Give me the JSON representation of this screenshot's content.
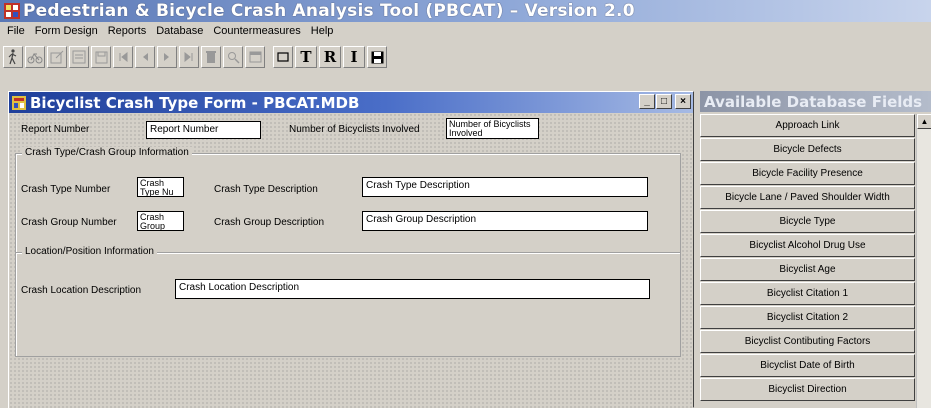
{
  "app": {
    "title": "Pedestrian & Bicycle Crash Analysis Tool (PBCAT) – Version 2.0",
    "menu": [
      "File",
      "Form Design",
      "Reports",
      "Database",
      "Countermeasures",
      "Help"
    ]
  },
  "toolbar": {
    "buttons": [
      "pedestrian-icon",
      "bicycle-icon",
      "edit-icon",
      "form-icon",
      "save-icon",
      "first-record-icon",
      "prev-record-icon",
      "next-record-icon",
      "last-record-icon",
      "delete-icon",
      "find-icon",
      "window-icon"
    ],
    "text_buttons": {
      "textbox": "T",
      "report": "R",
      "italic": "I"
    }
  },
  "form": {
    "title": "Bicyclist Crash Type Form - PBCAT.MDB",
    "controls": {
      "minimize": "_",
      "maximize": "□",
      "close": "×"
    },
    "report_number_label": "Report Number",
    "report_number_value": "Report Number",
    "num_bicyclists_label": "Number of Bicyclists Involved",
    "num_bicyclists_value": "Number of Bicyclists Involved",
    "crash_group_section": "Crash Type/Crash Group Information",
    "crash_type_number_label": "Crash Type Number",
    "crash_type_number_value": "Crash Type Nu",
    "crash_type_desc_label": "Crash Type Description",
    "crash_type_desc_value": "Crash Type Description",
    "crash_group_number_label": "Crash Group Number",
    "crash_group_number_value": "Crash Group",
    "crash_group_desc_label": "Crash Group Description",
    "crash_group_desc_value": "Crash Group Description",
    "location_section": "Location/Position Information",
    "crash_location_label": "Crash Location Description",
    "crash_location_value": "Crash Location Description"
  },
  "fields_panel": {
    "title": "Available Database Fields",
    "items": [
      "Approach Link",
      "Bicycle Defects",
      "Bicycle Facility Presence",
      "Bicycle Lane / Paved Shoulder Width",
      "Bicycle Type",
      "Bicyclist  Alcohol Drug Use",
      "Bicyclist Age",
      "Bicyclist Citation 1",
      "Bicyclist Citation 2",
      "Bicyclist Contibuting Factors",
      "Bicyclist Date of Birth",
      "Bicyclist Direction"
    ]
  }
}
